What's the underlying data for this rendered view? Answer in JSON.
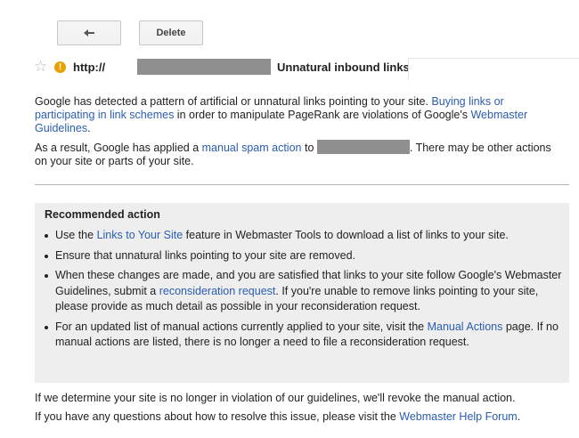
{
  "toolbar": {
    "back_icon": "back-arrow-icon",
    "delete_label": "Delete"
  },
  "subject": {
    "star_icon": "star-icon",
    "warning_icon": "warning-icon",
    "warning_glyph": "!",
    "url_prefix": "http://",
    "title": "Unnatural inbound links"
  },
  "body": {
    "p1_a": "Google has detected a pattern of artificial or unnatural links pointing to your site. ",
    "p1_link1": "Buying links or participating in link schemes",
    "p1_b": " in order to manipulate PageRank are violations of Google's ",
    "p1_link2": "Webmaster Guidelines",
    "p1_c": ".",
    "p2_a": "As a result, Google has applied a ",
    "p2_link": "manual spam action",
    "p2_b": " to ",
    "p2_c": ". There may be other actions on your site or parts of your site."
  },
  "recommended": {
    "title": "Recommended action",
    "item1_a": "Use the ",
    "item1_link": "Links to Your Site",
    "item1_b": " feature in Webmaster Tools to download a list of links to your site.",
    "item2": "Ensure that unnatural links pointing to your site are removed.",
    "item3_a": "When these changes are made, and you are satisfied that links to your site follow Google's Webmaster Guidelines, submit a ",
    "item3_link": "reconsideration request",
    "item3_b": ". If you're unable to remove links pointing to your site, please provide as much detail as possible in your reconsideration request.",
    "item4_a": "For an updated list of manual actions currently applied to your site, visit the ",
    "item4_link": "Manual Actions",
    "item4_b": " page. If no manual actions are listed, there is no longer a need to file a reconsideration request."
  },
  "footer": {
    "line1": "If we determine your site is no longer in violation of our guidelines, we'll revoke the manual action.",
    "line2_a": "If you have any questions about how to resolve this issue, please visit the ",
    "line2_link": "Webmaster Help Forum",
    "line2_b": "."
  },
  "colors": {
    "link": "#2a5db0",
    "warning": "#e8a200",
    "redaction": "#8f8f8f",
    "panel_bg": "#eeeeee"
  }
}
